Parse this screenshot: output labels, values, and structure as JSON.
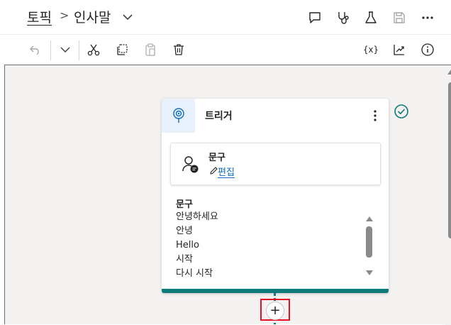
{
  "breadcrumb": {
    "topic": "토픽",
    "separator": ">",
    "current": "인사말"
  },
  "header_icons": [
    "chat-bubble-icon",
    "stethoscope-icon",
    "flask-icon",
    "save-icon",
    "more-icon"
  ],
  "toolbar_icons": {
    "left": [
      "undo-icon",
      "chevron-down-icon",
      "cut-icon",
      "copy-icon",
      "paste-icon",
      "delete-icon"
    ],
    "right": [
      "variables-icon",
      "analytics-icon",
      "info-icon"
    ],
    "variables_label": "{x}"
  },
  "trigger_card": {
    "title": "트리거",
    "phrase_label": "문구",
    "edit_label": "편집",
    "list_title": "문구",
    "phrases": [
      "안녕하세요",
      "안녕",
      "Hello",
      "시작",
      "다시 시작"
    ]
  },
  "colors": {
    "accent_teal": "#0e7a7a",
    "link": "#0f6cbd",
    "highlight": "#e81123"
  },
  "add_node": {
    "label": "+"
  }
}
